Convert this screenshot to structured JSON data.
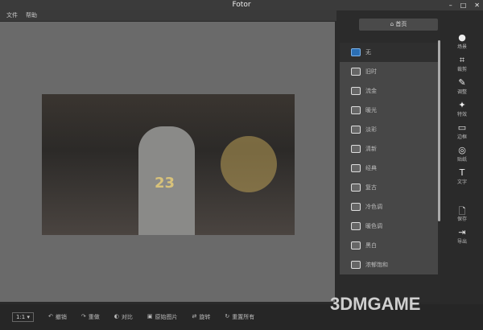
{
  "window": {
    "title": "Fotor",
    "min": "–",
    "max": "□",
    "close": "✕"
  },
  "menu": [
    "文件",
    "帮助"
  ],
  "panel": {
    "home_label": "首页",
    "items": [
      {
        "label": "无"
      },
      {
        "label": "旧时"
      },
      {
        "label": "流金"
      },
      {
        "label": "暖光"
      },
      {
        "label": "淡彩"
      },
      {
        "label": "清新"
      },
      {
        "label": "经典"
      },
      {
        "label": "复古"
      },
      {
        "label": "冷色调"
      },
      {
        "label": "暖色调"
      },
      {
        "label": "黑白"
      },
      {
        "label": "浓郁饱和"
      }
    ]
  },
  "tools": [
    {
      "icon": "●",
      "label": "场景"
    },
    {
      "icon": "⌗",
      "label": "裁剪"
    },
    {
      "icon": "✎",
      "label": "调整"
    },
    {
      "icon": "✦",
      "label": "特效"
    },
    {
      "icon": "▭",
      "label": "边框"
    },
    {
      "icon": "◎",
      "label": "贴纸"
    },
    {
      "icon": "T",
      "label": "文字"
    },
    {
      "icon": "🗋",
      "label": "保存"
    },
    {
      "icon": "⇥",
      "label": "导出"
    }
  ],
  "bottom": {
    "zoom": "1:1 ▾",
    "buttons": [
      {
        "icon": "↶",
        "label": "撤销"
      },
      {
        "icon": "↷",
        "label": "重做"
      },
      {
        "icon": "◐",
        "label": "对比"
      },
      {
        "icon": "▣",
        "label": "原始图片"
      },
      {
        "icon": "⇄",
        "label": "旋转"
      },
      {
        "icon": "↻",
        "label": "重置所有"
      }
    ]
  },
  "photo": {
    "jersey_number": "23"
  },
  "watermark": "3DMGAME"
}
